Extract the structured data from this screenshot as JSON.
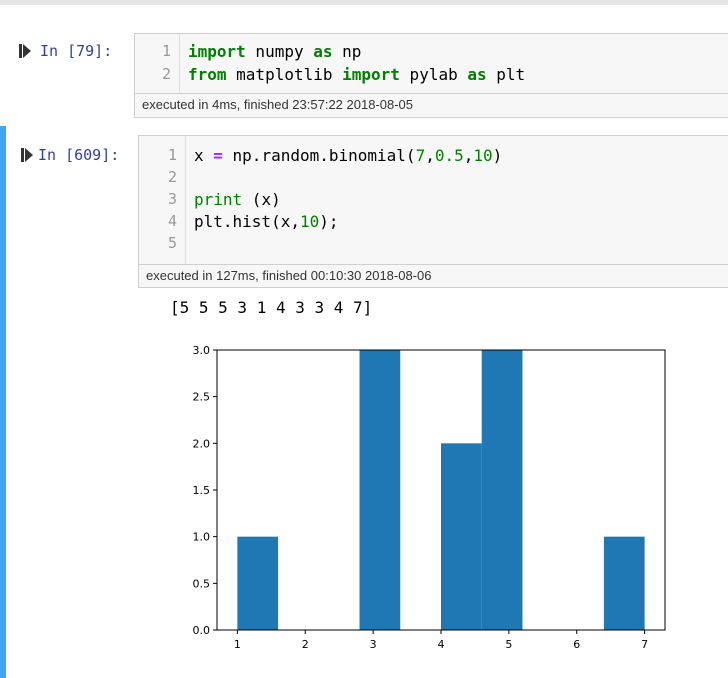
{
  "cells": [
    {
      "prompt": "In [79]:",
      "lines": [
        "1",
        "2"
      ],
      "code": [
        [
          {
            "t": "import",
            "c": "kw"
          },
          {
            "t": " numpy ",
            "c": ""
          },
          {
            "t": "as",
            "c": "kw"
          },
          {
            "t": " np",
            "c": ""
          }
        ],
        [
          {
            "t": "from",
            "c": "kw"
          },
          {
            "t": " matplotlib ",
            "c": ""
          },
          {
            "t": "import",
            "c": "kw"
          },
          {
            "t": " pylab ",
            "c": ""
          },
          {
            "t": "as",
            "c": "kw"
          },
          {
            "t": " plt",
            "c": ""
          }
        ]
      ],
      "exec_text": "executed in 4ms, finished 23:57:22 2018-08-05"
    },
    {
      "prompt": "In [609]:",
      "lines": [
        "1",
        "2",
        "3",
        "4",
        "5"
      ],
      "code": [
        [
          {
            "t": "x ",
            "c": ""
          },
          {
            "t": "=",
            "c": "op"
          },
          {
            "t": " np.random.binomial(",
            "c": ""
          },
          {
            "t": "7",
            "c": "num"
          },
          {
            "t": ",",
            "c": ""
          },
          {
            "t": "0.5",
            "c": "num"
          },
          {
            "t": ",",
            "c": ""
          },
          {
            "t": "10",
            "c": "num"
          },
          {
            "t": ")",
            "c": ""
          }
        ],
        [],
        [
          {
            "t": "print",
            "c": "bi"
          },
          {
            "t": " (x)",
            "c": ""
          }
        ],
        [
          {
            "t": "plt.hist(x,",
            "c": ""
          },
          {
            "t": "10",
            "c": "num"
          },
          {
            "t": ");",
            "c": ""
          }
        ],
        []
      ],
      "exec_text": "executed in 127ms, finished 00:10:30 2018-08-06",
      "stdout": "[5 5 5 3 1 4 3 3 4 7]"
    }
  ],
  "colors": {
    "bar": "#1f77b4",
    "selected_border": "#42a5f5",
    "prompt": "#303f9f",
    "keyword": "#008000",
    "operator": "#aa22ff"
  },
  "chart_data": {
    "type": "bar",
    "title": "",
    "xlabel": "",
    "ylabel": "",
    "bins": [
      {
        "x0": 1.0,
        "x1": 1.6,
        "value": 1
      },
      {
        "x0": 1.6,
        "x1": 2.2,
        "value": 0
      },
      {
        "x0": 2.2,
        "x1": 2.8,
        "value": 0
      },
      {
        "x0": 2.8,
        "x1": 3.4,
        "value": 3
      },
      {
        "x0": 3.4,
        "x1": 4.0,
        "value": 0
      },
      {
        "x0": 4.0,
        "x1": 4.6,
        "value": 2
      },
      {
        "x0": 4.6,
        "x1": 5.2,
        "value": 3
      },
      {
        "x0": 5.2,
        "x1": 5.8,
        "value": 0
      },
      {
        "x0": 5.8,
        "x1": 6.4,
        "value": 0
      },
      {
        "x0": 6.4,
        "x1": 7.0,
        "value": 1
      }
    ],
    "xlim": [
      0.7,
      7.3
    ],
    "ylim": [
      0.0,
      3.0
    ],
    "xticks": [
      1,
      2,
      3,
      4,
      5,
      6,
      7
    ],
    "xtick_labels": [
      "1",
      "2",
      "3",
      "4",
      "5",
      "6",
      "7"
    ],
    "yticks": [
      0.0,
      0.5,
      1.0,
      1.5,
      2.0,
      2.5,
      3.0
    ],
    "ytick_labels": [
      "0.0",
      "0.5",
      "1.0",
      "1.5",
      "2.0",
      "2.5",
      "3.0"
    ],
    "grid": false
  }
}
